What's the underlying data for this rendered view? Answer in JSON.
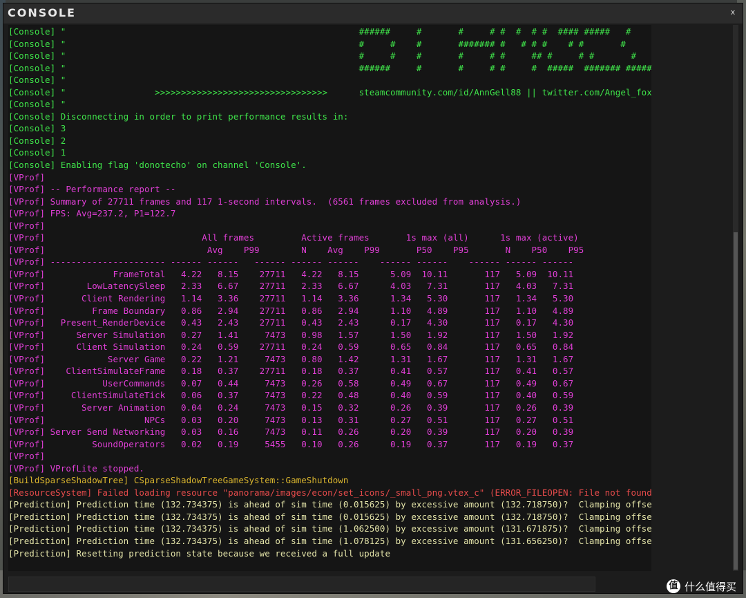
{
  "window": {
    "title": "CONSOLE",
    "close_label": "x",
    "input_value": "",
    "input_placeholder": ""
  },
  "colors": {
    "console": "#3fe34a",
    "vprof": "#e03fd6",
    "build": "#d8b42e",
    "resource": "#e64b4b",
    "prediction": "#e3e3a8"
  },
  "watermark": {
    "text": "什么值得买",
    "logo": "值"
  },
  "log": [
    {
      "c": "console",
      "t": "[Console] \"                                                        ######     #       #     # #  #  # #  #### #####   #"
    },
    {
      "c": "console",
      "t": "[Console] \"                                                        #     #    #       ####### #   # # #    # #       #"
    },
    {
      "c": "console",
      "t": "[Console] \"                                                        #     #    #       #     # #     ## #     # #       #"
    },
    {
      "c": "console",
      "t": "[Console] \"                                                        ######     #       #     # #     #  #####  ####### #######"
    },
    {
      "c": "console",
      "t": "[Console] \""
    },
    {
      "c": "console",
      "t": "[Console] \"                 >>>>>>>>>>>>>>>>>>>>>>>>>>>>>>>>>      steamcommunity.com/id/AnnGell88 || twitter.com/Angel_foxxo      <<<<<<<<<<<<<<<<<<<<<<<<<<<<<<<<<"
    },
    {
      "c": "console",
      "t": "[Console] \""
    },
    {
      "c": "console",
      "t": "[Console] Disconnecting in order to print performance results in:"
    },
    {
      "c": "console",
      "t": "[Console] 3"
    },
    {
      "c": "console",
      "t": "[Console] 2"
    },
    {
      "c": "console",
      "t": "[Console] 1"
    },
    {
      "c": "console",
      "t": "[Console] Enabling flag 'donotecho' on channel 'Console'."
    },
    {
      "c": "vprof",
      "t": "[VProf]"
    },
    {
      "c": "vprof",
      "t": "[VProf] -- Performance report --"
    },
    {
      "c": "vprof",
      "t": "[VProf] Summary of 27711 frames and 117 1-second intervals.  (6561 frames excluded from analysis.)"
    },
    {
      "c": "vprof",
      "t": "[VProf] FPS: Avg=237.2, P1=122.7"
    },
    {
      "c": "vprof",
      "t": "[VProf]"
    },
    {
      "c": "vprof",
      "t": "[VProf]                              All frames         Active frames       1s max (all)      1s max (active)"
    },
    {
      "c": "vprof",
      "t": "[VProf]                               Avg    P99        N    Avg    P99       P50    P95       N    P50    P95"
    },
    {
      "c": "vprof",
      "t": "[VProf] ---------------------- ------ ------   ------ ------ ------    ------ ------    ------ ------ ------"
    },
    {
      "c": "vprof",
      "t": "[VProf]             FrameTotal   4.22   8.15    27711   4.22   8.15      5.09  10.11       117   5.09  10.11"
    },
    {
      "c": "vprof",
      "t": "[VProf]        LowLatencySleep   2.33   6.67    27711   2.33   6.67      4.03   7.31       117   4.03   7.31"
    },
    {
      "c": "vprof",
      "t": "[VProf]       Client Rendering   1.14   3.36    27711   1.14   3.36      1.34   5.30       117   1.34   5.30"
    },
    {
      "c": "vprof",
      "t": "[VProf]         Frame Boundary   0.86   2.94    27711   0.86   2.94      1.10   4.89       117   1.10   4.89"
    },
    {
      "c": "vprof",
      "t": "[VProf]   Present_RenderDevice   0.43   2.43    27711   0.43   2.43      0.17   4.30       117   0.17   4.30"
    },
    {
      "c": "vprof",
      "t": "[VProf]      Server Simulation   0.27   1.41     7473   0.98   1.57      1.50   1.92       117   1.50   1.92"
    },
    {
      "c": "vprof",
      "t": "[VProf]      Client Simulation   0.24   0.59    27711   0.24   0.59      0.65   0.84       117   0.65   0.84"
    },
    {
      "c": "vprof",
      "t": "[VProf]            Server Game   0.22   1.21     7473   0.80   1.42      1.31   1.67       117   1.31   1.67"
    },
    {
      "c": "vprof",
      "t": "[VProf]    ClientSimulateFrame   0.18   0.37    27711   0.18   0.37      0.41   0.57       117   0.41   0.57"
    },
    {
      "c": "vprof",
      "t": "[VProf]           UserCommands   0.07   0.44     7473   0.26   0.58      0.49   0.67       117   0.49   0.67"
    },
    {
      "c": "vprof",
      "t": "[VProf]     ClientSimulateTick   0.06   0.37     7473   0.22   0.48      0.40   0.59       117   0.40   0.59"
    },
    {
      "c": "vprof",
      "t": "[VProf]       Server Animation   0.04   0.24     7473   0.15   0.32      0.26   0.39       117   0.26   0.39"
    },
    {
      "c": "vprof",
      "t": "[VProf]                   NPCs   0.03   0.20     7473   0.13   0.31      0.27   0.51       117   0.27   0.51"
    },
    {
      "c": "vprof",
      "t": "[VProf] Server Send Networking   0.03   0.16     7473   0.11   0.26      0.20   0.39       117   0.20   0.39"
    },
    {
      "c": "vprof",
      "t": "[VProf]         SoundOperators   0.02   0.19     5455   0.10   0.26      0.19   0.37       117   0.19   0.37"
    },
    {
      "c": "vprof",
      "t": "[VProf]"
    },
    {
      "c": "vprof",
      "t": "[VProf] VProfLite stopped."
    },
    {
      "c": "build",
      "t": "[BuildSparseShadowTree] CSparseShadowTreeGameSystem::GameShutdown"
    },
    {
      "c": "resource",
      "t": "[ResourceSystem] Failed loading resource \"panorama/images/econ/set_icons/_small_png.vtex_c\" (ERROR_FILEOPEN: File not found)"
    },
    {
      "c": "prediction",
      "t": "[Prediction] Prediction time (132.734375) is ahead of sim time (0.015625) by excessive amount (132.718750)?  Clamping offset"
    },
    {
      "c": "prediction",
      "t": "[Prediction] Prediction time (132.734375) is ahead of sim time (0.015625) by excessive amount (132.718750)?  Clamping offset"
    },
    {
      "c": "prediction",
      "t": "[Prediction] Prediction time (132.734375) is ahead of sim time (1.062500) by excessive amount (131.671875)?  Clamping offset"
    },
    {
      "c": "prediction",
      "t": "[Prediction] Prediction time (132.734375) is ahead of sim time (1.078125) by excessive amount (131.656250)?  Clamping offset"
    },
    {
      "c": "prediction",
      "t": "[Prediction] Resetting prediction state because we received a full update"
    }
  ]
}
